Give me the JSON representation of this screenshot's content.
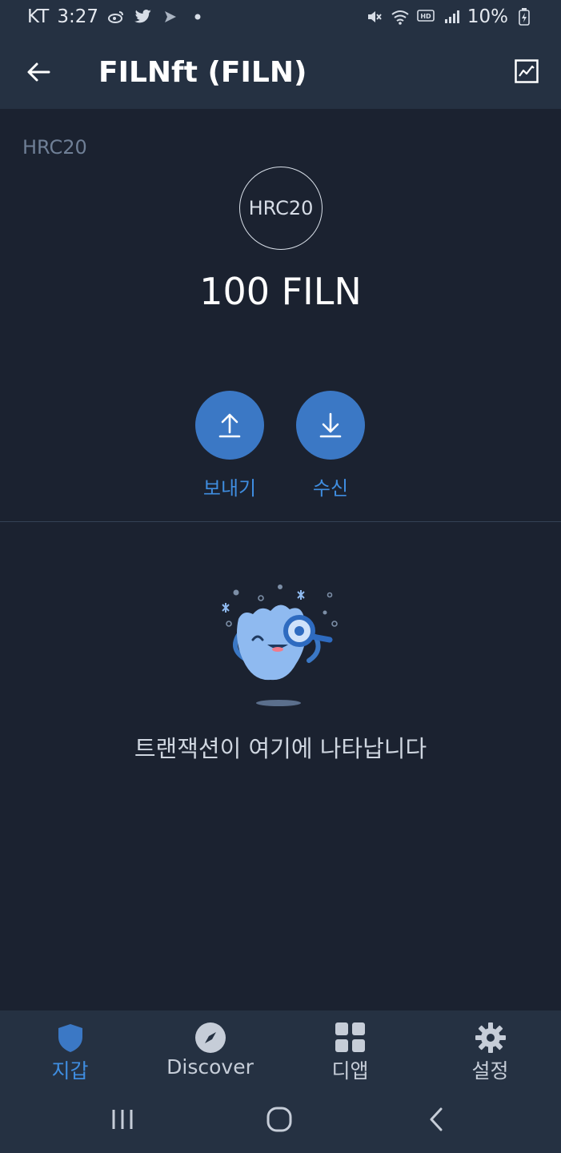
{
  "status_bar": {
    "carrier": "KT",
    "time": "3:27",
    "left_icons": [
      "weibo-icon",
      "twitter-icon",
      "send-icon",
      "dot-icon"
    ],
    "right_icons": [
      "mute-icon",
      "wifi-icon",
      "hd-icon",
      "signal-icon",
      "battery-icon"
    ],
    "battery": "10%"
  },
  "app_bar": {
    "title": "FILNft (FILN)",
    "back_icon": "arrow-left-icon",
    "chart_icon": "chart-icon"
  },
  "token": {
    "type_label": "HRC20",
    "logo_text": "HRC20",
    "balance": "100 FILN"
  },
  "actions": {
    "send_label": "보내기",
    "receive_label": "수신"
  },
  "empty_state": {
    "message": "트랜잭션이 여기에 나타납니다"
  },
  "bottom_nav": {
    "items": [
      {
        "label": "지갑",
        "icon": "shield-icon",
        "active": true
      },
      {
        "label": "Discover",
        "icon": "compass-icon",
        "active": false
      },
      {
        "label": "디앱",
        "icon": "grid-icon",
        "active": false
      },
      {
        "label": "설정",
        "icon": "gear-icon",
        "active": false
      }
    ]
  },
  "colors": {
    "background": "#1b2230",
    "bar": "#253142",
    "accent": "#3b78c5",
    "accent_text": "#3f8de0"
  }
}
